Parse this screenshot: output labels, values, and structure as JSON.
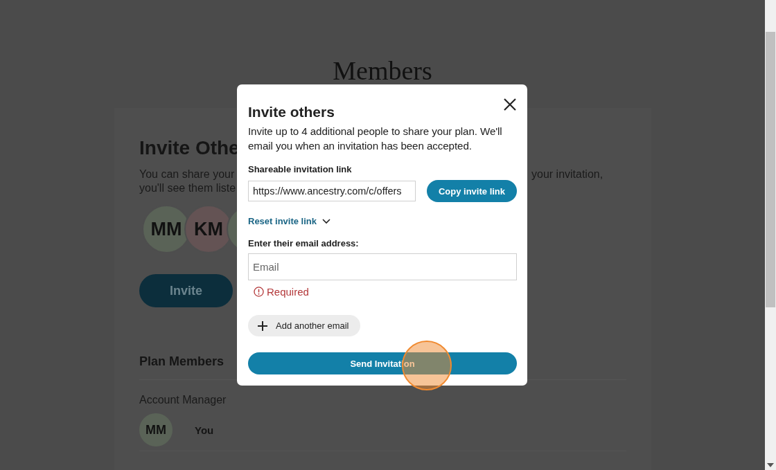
{
  "page": {
    "title": "Members"
  },
  "invite_section": {
    "title": "Invite Othe",
    "description_line_1_left": "You can share your",
    "description_line_1_right": "your invitation,",
    "description_line_2": "you'll see them liste",
    "avatars": [
      {
        "initials": "MM",
        "color": "#5a6357"
      },
      {
        "initials": "KM",
        "color": "#645354"
      },
      {
        "color": "#5a6357"
      }
    ],
    "invite_button": "Invite"
  },
  "plan_members": {
    "title": "Plan Members",
    "role": "Account Manager",
    "member": {
      "initials": "MM",
      "name": "You"
    }
  },
  "modal": {
    "title": "Invite others",
    "description": "Invite up to 4 additional people to share your plan. We'll email you when an invitation has been accepted.",
    "link_label": "Shareable invitation link",
    "link_value": "https://www.ancestry.com/c/offers",
    "copy_button": "Copy invite link",
    "reset_link": "Reset invite link",
    "email_label": "Enter their email address:",
    "email_placeholder": "Email",
    "error": "Required",
    "add_email_button": "Add another email",
    "send_button": "Send Invitation"
  }
}
